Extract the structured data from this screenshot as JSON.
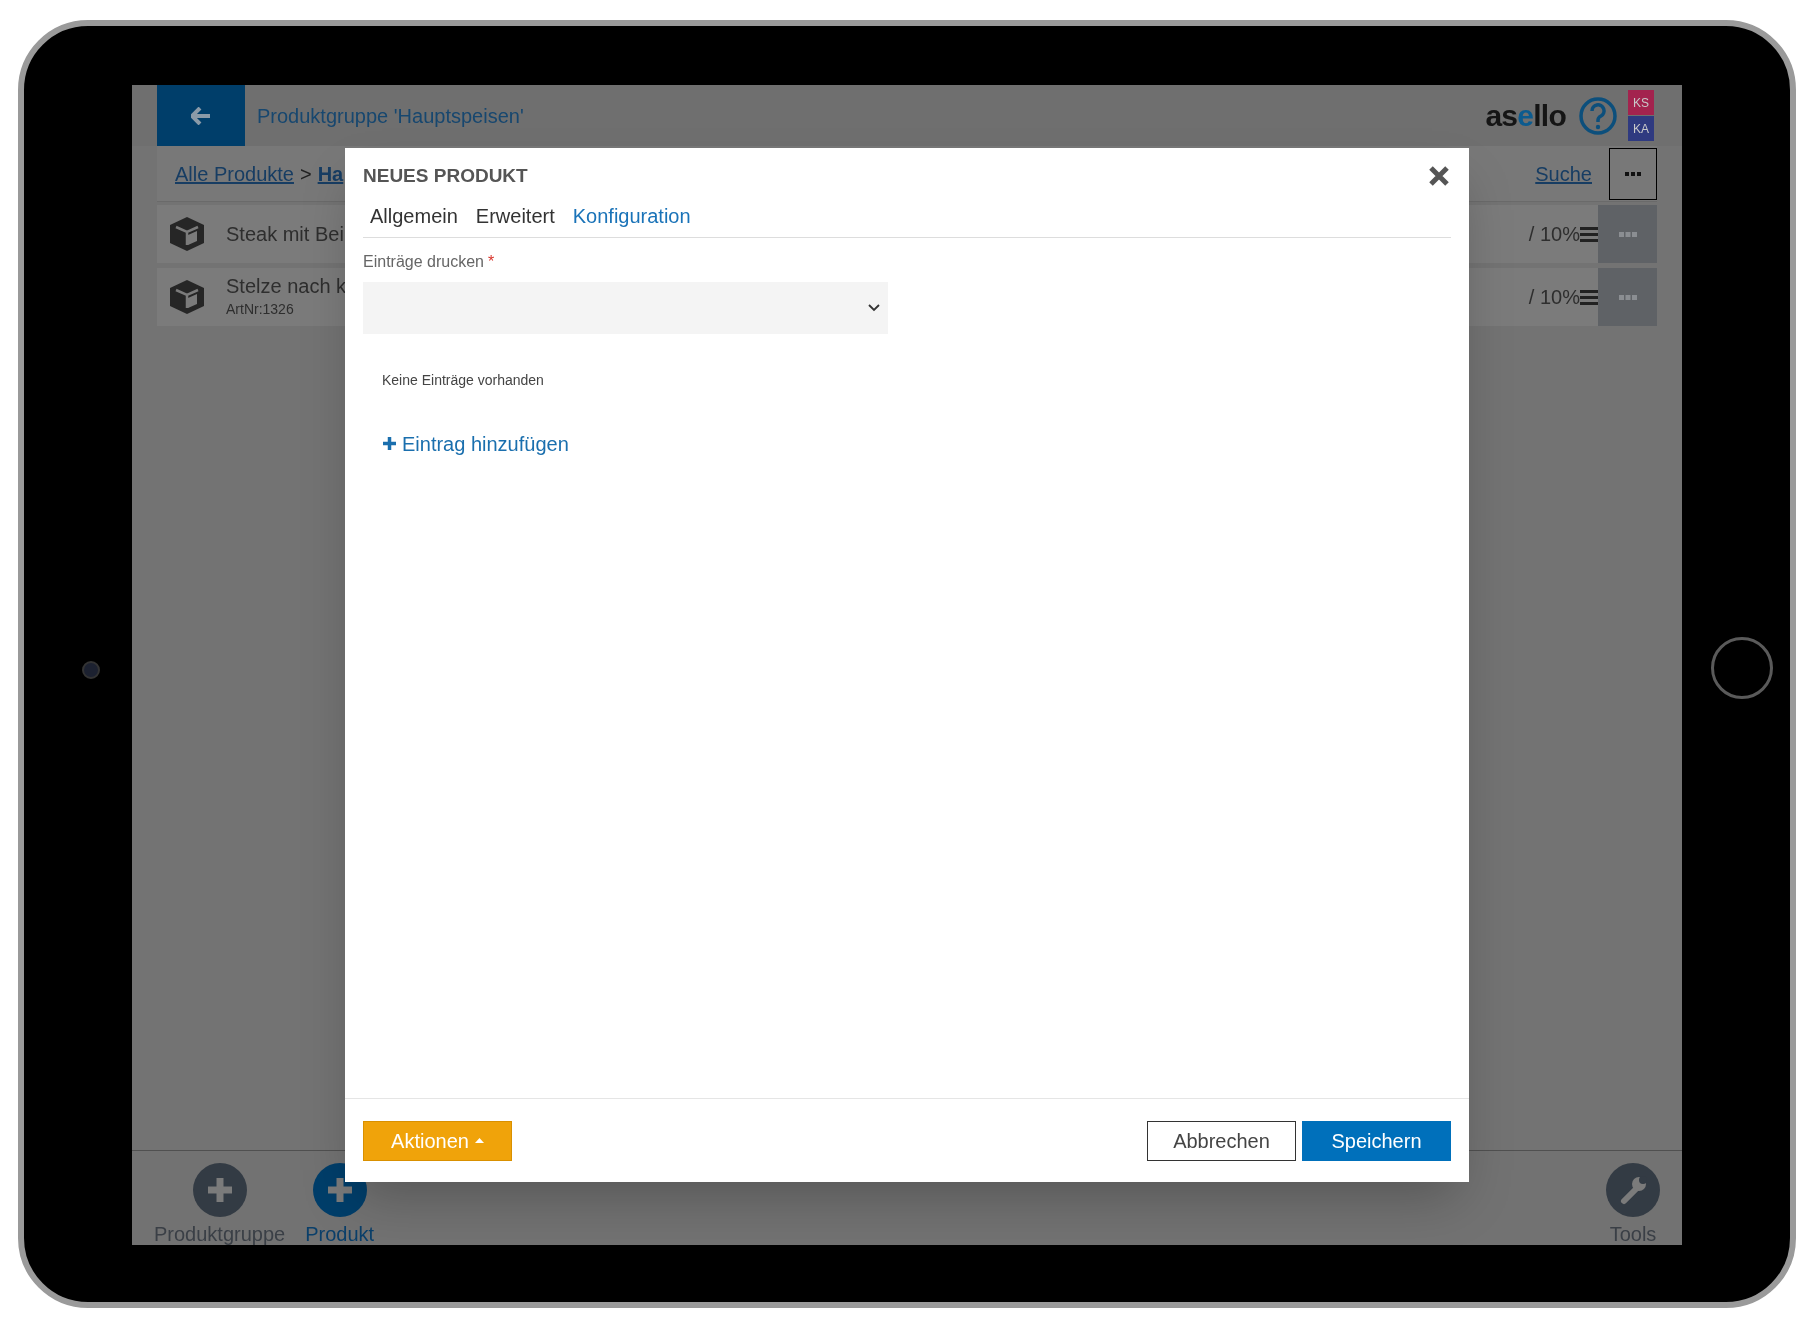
{
  "header": {
    "title": "Produktgruppe 'Hauptspeisen'",
    "logo": [
      "as",
      "e",
      "llo"
    ],
    "user_badges": [
      {
        "label": "KS",
        "color": "#a3234e"
      },
      {
        "label": "KA",
        "color": "#2f3a80"
      }
    ]
  },
  "breadcrumb": {
    "items": [
      {
        "label": "Alle Produkte",
        "kind": "link"
      },
      {
        "label": "Ha",
        "kind": "current"
      }
    ],
    "separator": ">",
    "search_link": "Suche"
  },
  "products": [
    {
      "name": "Steak mit Bei",
      "price": "/ 10%"
    },
    {
      "name": "Stelze nach k",
      "sku": "ArtNr:1326",
      "price": "/ 10%"
    }
  ],
  "bottom_actions": [
    {
      "label": "Produktgruppe",
      "kind": "add",
      "selected": false
    },
    {
      "label": "Produkt",
      "kind": "add",
      "selected": true
    },
    {
      "label": "Tools",
      "kind": "tools",
      "selected": false
    }
  ],
  "dialog": {
    "title": "NEUES PRODUKT",
    "tabs": [
      {
        "label": "Allgemein",
        "selected": false
      },
      {
        "label": "Erweitert",
        "selected": false
      },
      {
        "label": "Konfiguration",
        "selected": true
      }
    ],
    "field": {
      "label": "Einträge drucken",
      "required_mark": "*"
    },
    "empty_text": "Keine Einträge vorhanden",
    "add_link": "Eintrag hinzufügen",
    "buttons": [
      {
        "label": "Aktionen",
        "kind": "menu"
      },
      {
        "label": "Abbrechen",
        "kind": "secondary"
      },
      {
        "label": "Speichern",
        "kind": "primary"
      }
    ]
  }
}
